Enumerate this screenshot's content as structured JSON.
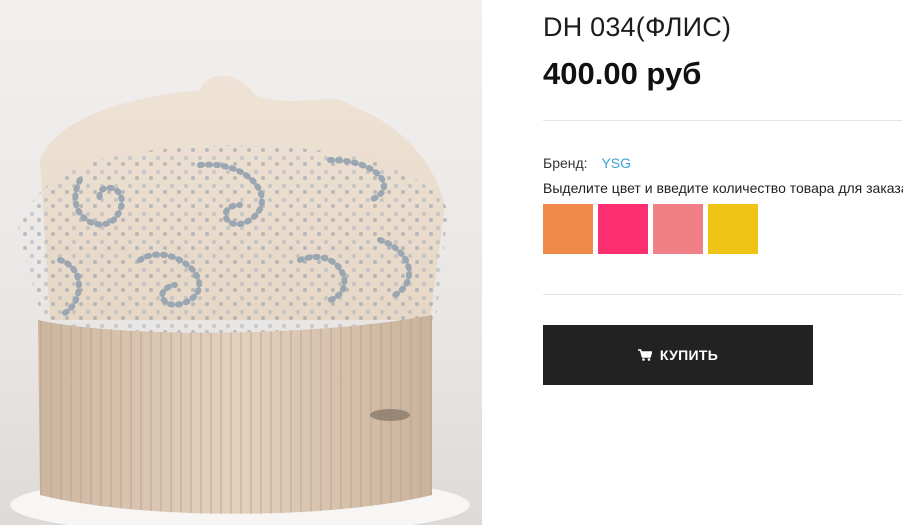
{
  "product": {
    "title": "DH 034(ФЛИС)",
    "price": "400.00 руб",
    "brand_label": "Бренд:",
    "brand_name": "YSG",
    "color_hint": "Выделите цвет и введите количество товара для заказа",
    "photo_subject": "knitted-beanie-with-rhinestones",
    "swatches": [
      {
        "name": "orange",
        "color": "#f08a4b"
      },
      {
        "name": "pink",
        "color": "#fb2e6f"
      },
      {
        "name": "coral",
        "color": "#f07f86"
      },
      {
        "name": "yellow",
        "color": "#f0c417"
      }
    ]
  },
  "buy_button": {
    "label": "КУПИТЬ",
    "icon": "cart-icon"
  },
  "colors": {
    "button_bg": "#222222",
    "brand_link": "#3aa3d8"
  }
}
